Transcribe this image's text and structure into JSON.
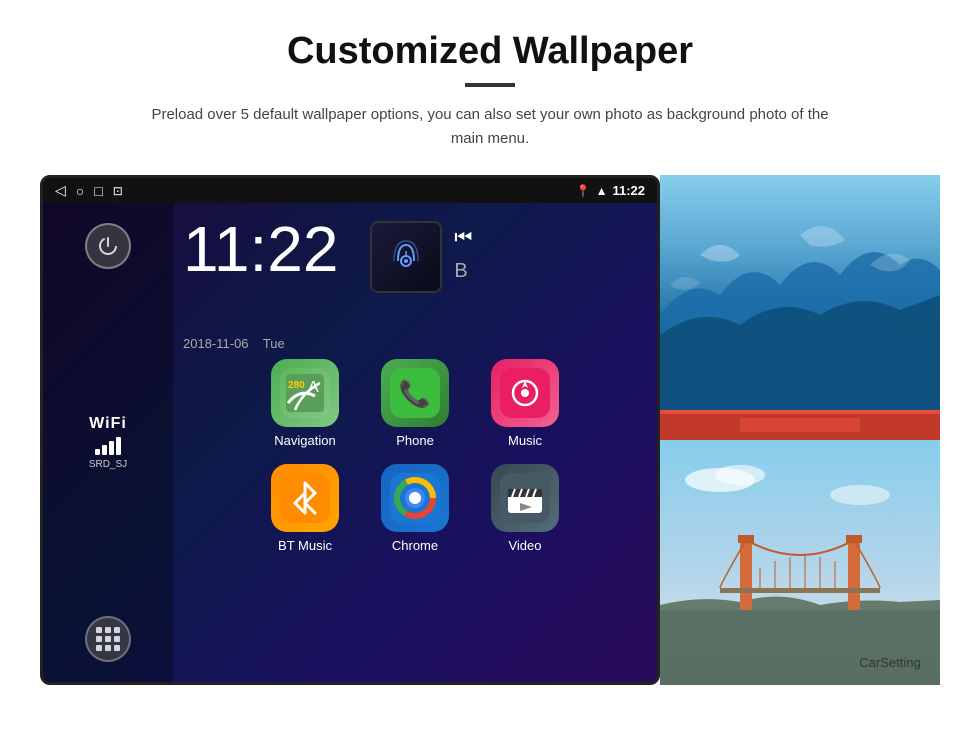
{
  "header": {
    "title": "Customized Wallpaper",
    "divider": true,
    "subtitle": "Preload over 5 default wallpaper options, you can also set your own photo as background photo of the main menu."
  },
  "device": {
    "statusBar": {
      "time": "11:22",
      "date": "2018-11-06",
      "dayOfWeek": "Tue",
      "wifi": true,
      "signal": true
    },
    "clock": {
      "time": "11:22",
      "date": "2018-11-06",
      "dayOfWeek": "Tue"
    },
    "wifi": {
      "label": "WiFi",
      "ssid": "SRD_SJ"
    },
    "apps": [
      {
        "name": "Navigation",
        "icon": "navigation-icon",
        "row": 1,
        "col": 1
      },
      {
        "name": "Phone",
        "icon": "phone-icon",
        "row": 1,
        "col": 2
      },
      {
        "name": "Music",
        "icon": "music-icon",
        "row": 1,
        "col": 3
      },
      {
        "name": "BT Music",
        "icon": "bt-music-icon",
        "row": 2,
        "col": 1
      },
      {
        "name": "Chrome",
        "icon": "chrome-icon",
        "row": 2,
        "col": 2
      },
      {
        "name": "Video",
        "icon": "video-icon",
        "row": 2,
        "col": 3
      }
    ],
    "wallpapers": [
      {
        "name": "Blue Ice",
        "description": "Ice blue landscape wallpaper"
      },
      {
        "name": "Golden Gate Bridge",
        "description": "Golden Gate Bridge at sunset"
      }
    ]
  }
}
